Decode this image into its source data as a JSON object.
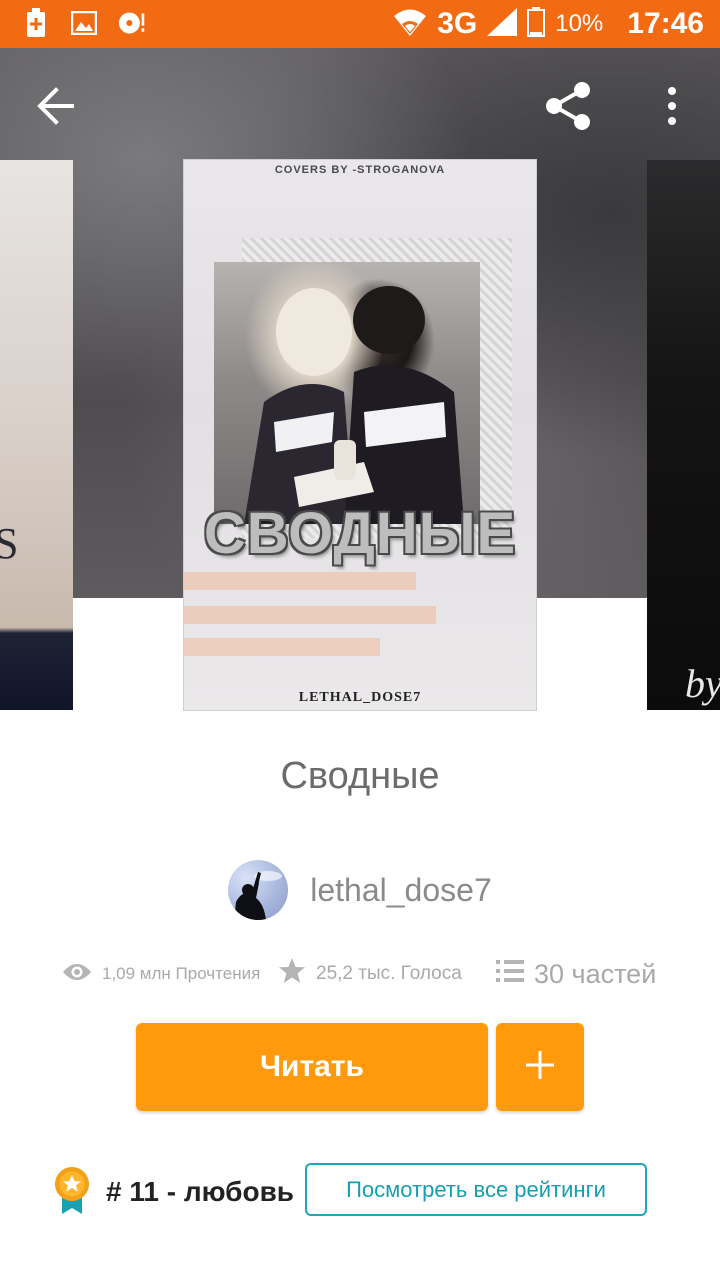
{
  "status_bar": {
    "network": "3G",
    "battery": "10%",
    "time": "17:46",
    "icons": [
      "battery-saver-icon",
      "image-icon",
      "media-disc-icon",
      "wifi-icon",
      "signal-icon",
      "battery-icon"
    ]
  },
  "toolbar": {
    "icons": [
      "back-arrow-icon",
      "share-icon",
      "more-vert-icon"
    ]
  },
  "cover": {
    "credit": "COVERS BY -STROGANOVA",
    "title_text": "СВОДНЫЕ",
    "author_text": "LETHAL_DOSE7",
    "left_peek_letter": "S",
    "right_peek_text": "by"
  },
  "book": {
    "title": "Сводные",
    "author": "lethal_dose7"
  },
  "stats": {
    "reads": "1,09 млн Прочтения",
    "votes": "25,2 тыс. Голоса",
    "parts": "30 частей"
  },
  "actions": {
    "read_label": "Читать",
    "add_label": "+"
  },
  "ranking": {
    "text": "# 11 - любовь",
    "view_all_label": "Посмотреть все рейтинги"
  },
  "colors": {
    "status_bar": "#f26b12",
    "primary_button": "#ff9a0c",
    "ratings_border": "#1aa7b8"
  }
}
